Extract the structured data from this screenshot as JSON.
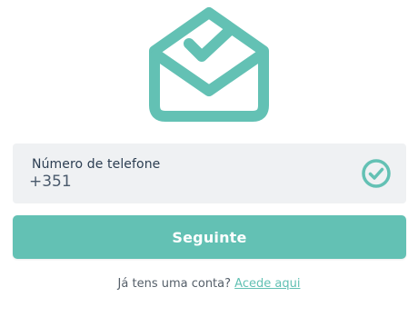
{
  "hero": {
    "icon": "envelope-check-icon",
    "color": "#63c1b4"
  },
  "phone": {
    "label": "Número de telefone",
    "value": "+351",
    "status_icon": "check-circle-icon"
  },
  "next_button": {
    "label": "Seguinte",
    "color": "#63c1b4"
  },
  "footer": {
    "prompt": "Já tens uma conta?",
    "link": "Acede aqui"
  }
}
